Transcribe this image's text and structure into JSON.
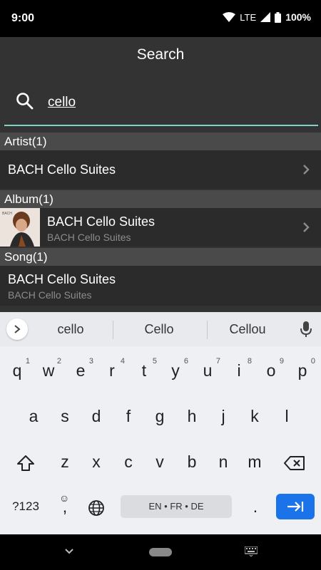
{
  "status_bar": {
    "time": "9:00",
    "network": "LTE",
    "battery": "100%"
  },
  "header": {
    "title": "Search"
  },
  "search": {
    "query": "cello"
  },
  "sections": {
    "artist": {
      "header": "Artist(1)",
      "item_title": "BACH Cello Suites"
    },
    "album": {
      "header": "Album(1)",
      "item_title": "BACH Cello Suites",
      "item_subtitle": "BACH Cello Suites"
    },
    "song": {
      "header": "Song(1)",
      "item_title": "BACH Cello Suites",
      "item_subtitle": "BACH Cello Suites"
    }
  },
  "keyboard": {
    "suggestions": [
      "cello",
      "Cello",
      "Cellou"
    ],
    "row1": [
      "q",
      "w",
      "e",
      "r",
      "t",
      "y",
      "u",
      "i",
      "o",
      "p"
    ],
    "row1_hints": [
      "1",
      "2",
      "3",
      "4",
      "5",
      "6",
      "7",
      "8",
      "9",
      "0"
    ],
    "row2": [
      "a",
      "s",
      "d",
      "f",
      "g",
      "h",
      "j",
      "k",
      "l"
    ],
    "row3": [
      "z",
      "x",
      "c",
      "v",
      "b",
      "n",
      "m"
    ],
    "symbols_label": "?123",
    "comma": ",",
    "period": ".",
    "space_label": "EN • FR • DE"
  }
}
